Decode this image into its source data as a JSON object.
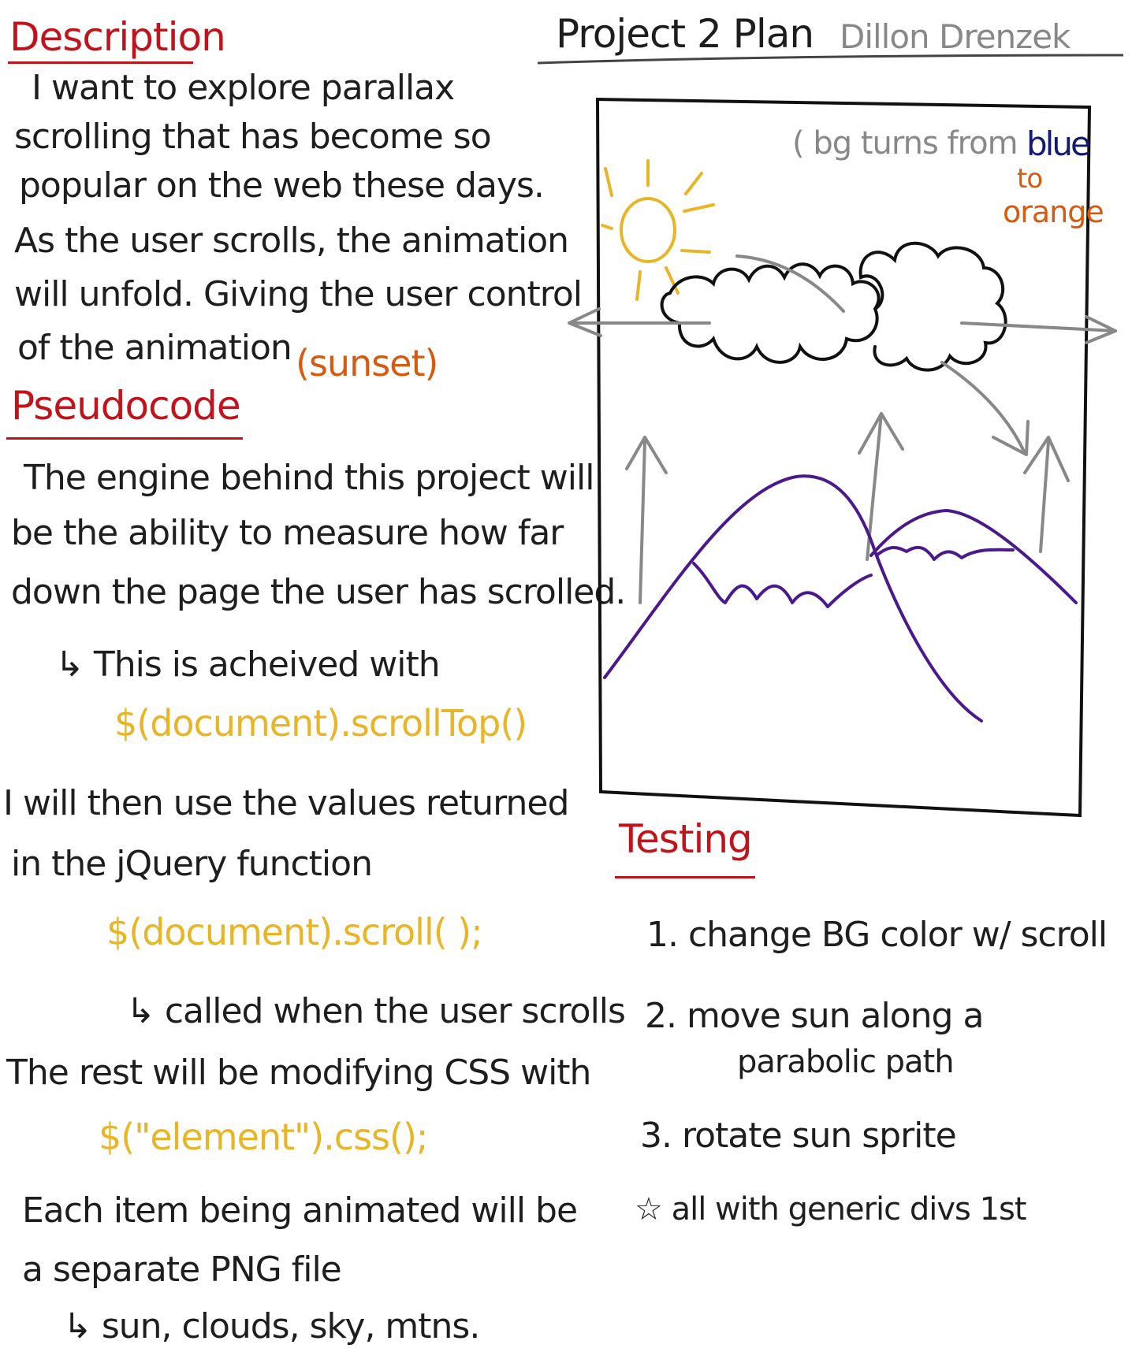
{
  "header": {
    "title": "Project 2 Plan",
    "author": "Dillon Drenzek"
  },
  "description": {
    "heading": "Description",
    "lines": [
      "I want to explore parallax",
      "scrolling that has become so",
      "popular on the web these days.",
      "As the user scrolls, the animation",
      "will unfold. Giving the user control",
      "of the animation"
    ],
    "note": "(sunset)"
  },
  "pseudocode": {
    "heading": "Pseudocode",
    "intro_lines": [
      "The engine behind this project will",
      "be the ability to measure how far",
      "down the page the user has scrolled."
    ],
    "arrow_note": "↳ This is acheived with",
    "code_scrolltop": "$(document).scrollTop()",
    "then_lines": [
      "I will then use the values returned",
      "in the jQuery function"
    ],
    "code_scroll": "$(document).scroll( );",
    "scroll_note": "↳ called when the user scrolls",
    "rest_line": "The rest will be modifying CSS with",
    "code_css": "$(\"element\").css();",
    "png_lines": [
      "Each item being animated will be",
      "a separate PNG file"
    ],
    "png_note": "↳ sun, clouds, sky, mtns."
  },
  "sketch": {
    "bg_note_prefix": "( bg turns from",
    "bg_note_blue": "blue",
    "bg_note_to": "to",
    "bg_note_orange": "orange"
  },
  "testing": {
    "heading": "Testing",
    "items": [
      "1. change BG color w/ scroll",
      "2. move sun along a",
      "parabolic path",
      "3. rotate sun sprite",
      "☆ all with generic divs 1st"
    ]
  },
  "colors": {
    "heading_red": "#c0141c",
    "note_orange": "#d65a10",
    "code_gold": "#e7b526",
    "sketch_gray": "#888888",
    "mountain_purple": "#4a1a8c",
    "blue_word": "#141a6e"
  }
}
